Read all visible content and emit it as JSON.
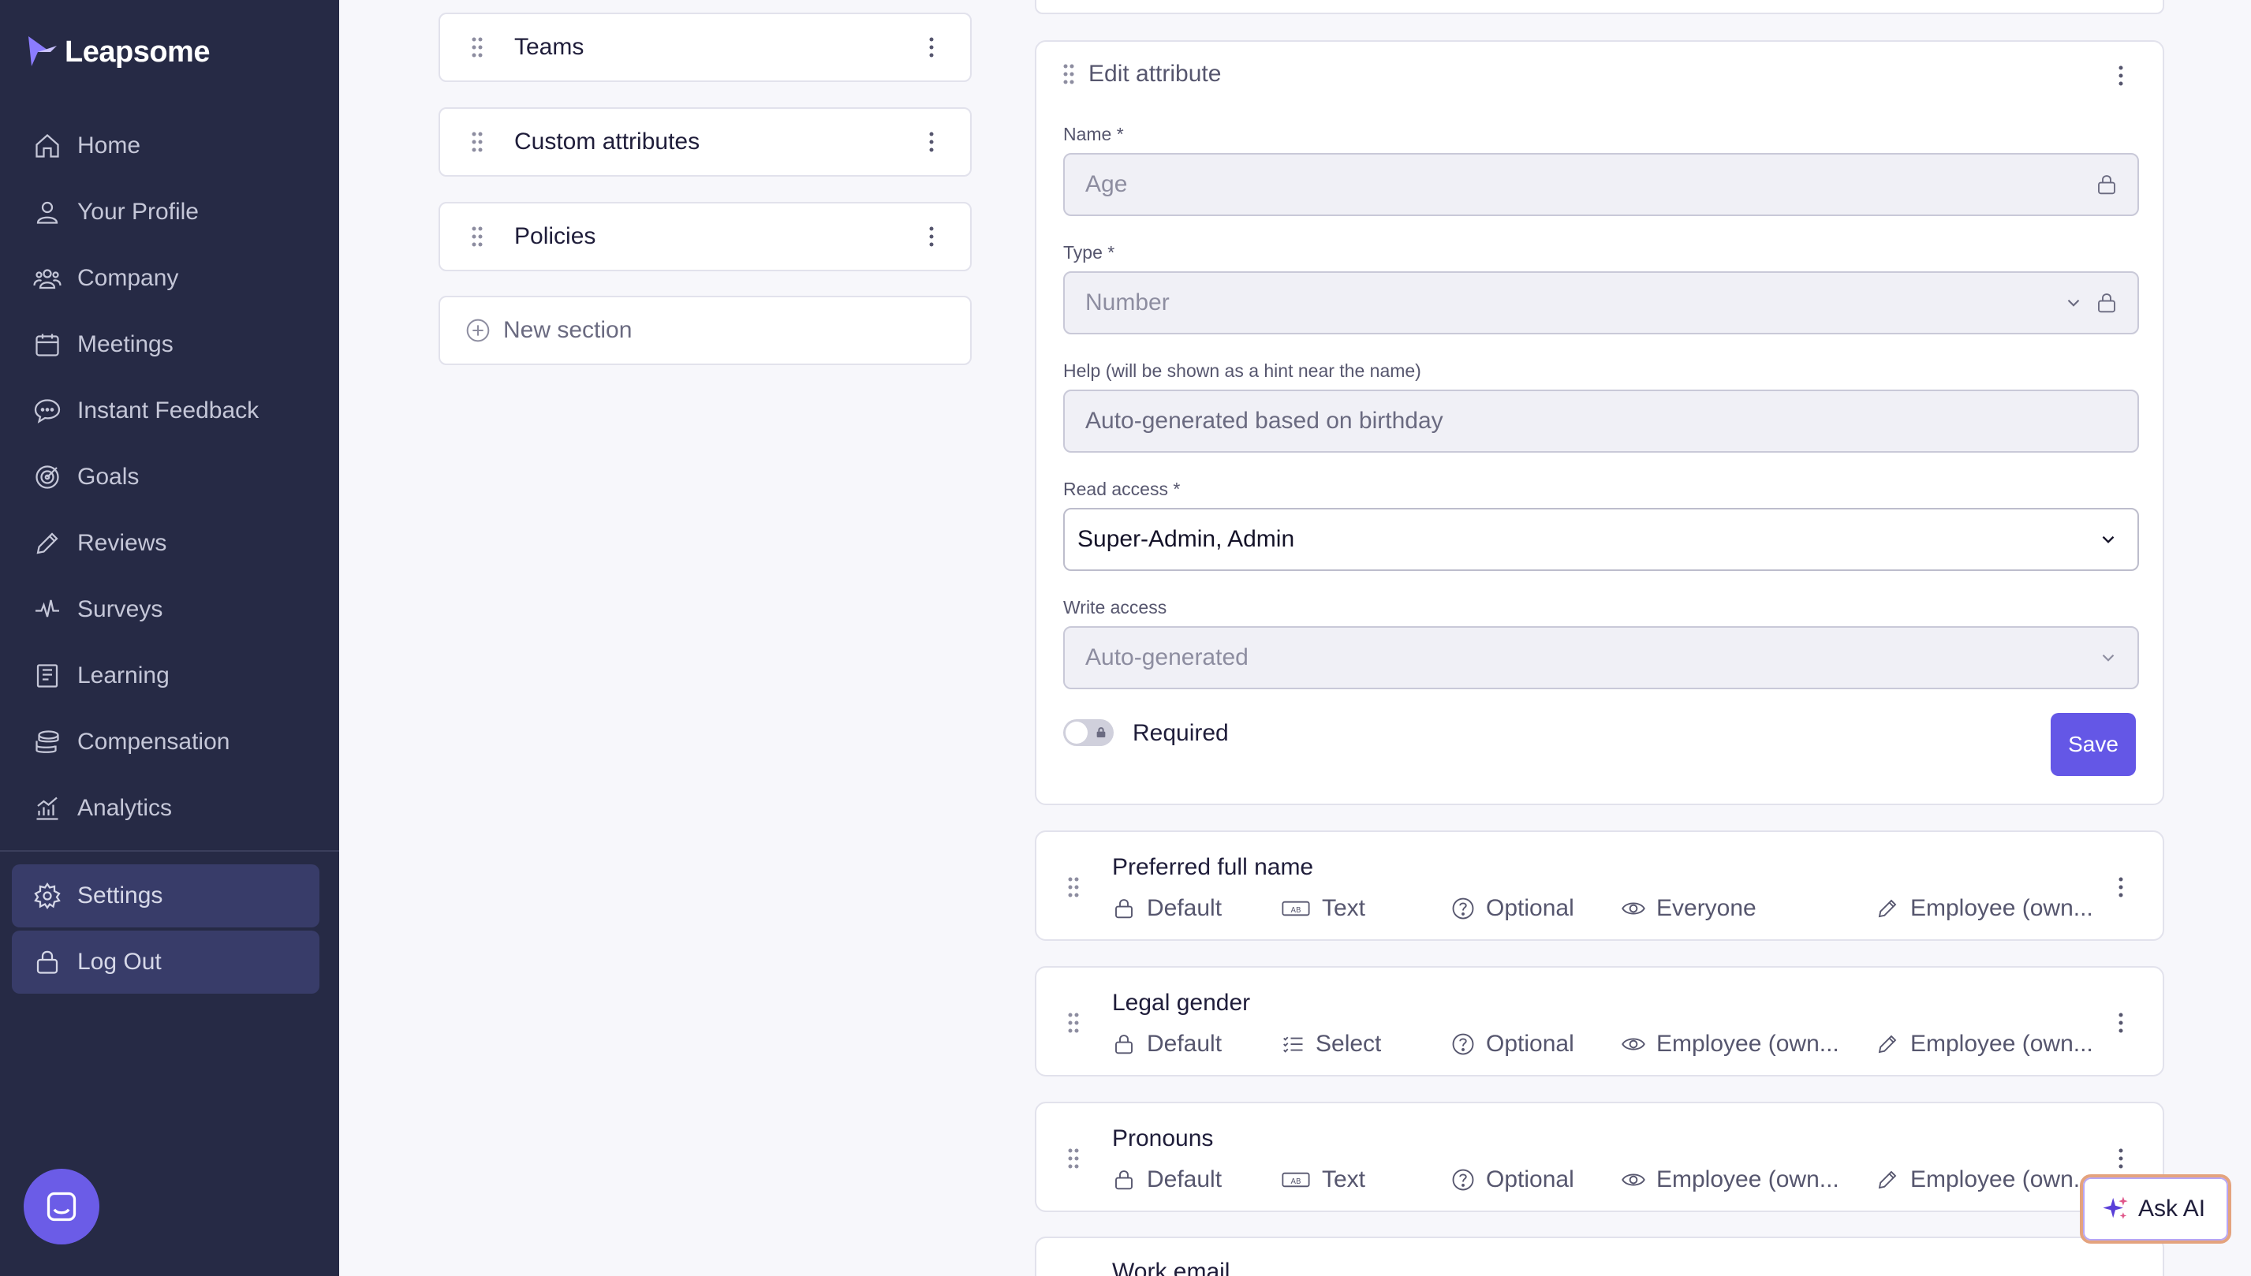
{
  "brand": {
    "name": "Leapsome",
    "accent": "#6457e6",
    "sidebar_bg": "#262a45"
  },
  "sidebar": {
    "items": [
      {
        "label": "Home",
        "icon": "home-icon"
      },
      {
        "label": "Your Profile",
        "icon": "user-icon"
      },
      {
        "label": "Company",
        "icon": "people-icon"
      },
      {
        "label": "Meetings",
        "icon": "calendar-icon"
      },
      {
        "label": "Instant Feedback",
        "icon": "chat-icon"
      },
      {
        "label": "Goals",
        "icon": "target-icon"
      },
      {
        "label": "Reviews",
        "icon": "pencil-icon"
      },
      {
        "label": "Surveys",
        "icon": "pulse-icon"
      },
      {
        "label": "Learning",
        "icon": "book-icon"
      },
      {
        "label": "Compensation",
        "icon": "coins-icon"
      },
      {
        "label": "Analytics",
        "icon": "chart-icon"
      }
    ],
    "settings_label": "Settings",
    "logout_label": "Log Out"
  },
  "sections": {
    "items": [
      "Teams",
      "Custom attributes",
      "Policies"
    ],
    "new_section_label": "New section"
  },
  "edit_attribute": {
    "title": "Edit attribute",
    "name_label": "Name *",
    "name_value": "Age",
    "type_label": "Type *",
    "type_value": "Number",
    "help_label": "Help (will be shown as a hint near the name)",
    "help_value": "Auto-generated based on birthday",
    "read_label": "Read access *",
    "read_value": "Super-Admin, Admin",
    "write_label": "Write access",
    "write_value": "Auto-generated",
    "required_label": "Required",
    "required_on": false,
    "save_label": "Save"
  },
  "attributes": [
    {
      "title": "Preferred full name",
      "origin": "Default",
      "type": "Text",
      "type_icon": "text-field-icon",
      "requirement": "Optional",
      "read": "Everyone",
      "write": "Employee (own..."
    },
    {
      "title": "Legal gender",
      "origin": "Default",
      "type": "Select",
      "type_icon": "list-icon",
      "requirement": "Optional",
      "read": "Employee (own...",
      "write": "Employee (own..."
    },
    {
      "title": "Pronouns",
      "origin": "Default",
      "type": "Text",
      "type_icon": "text-field-icon",
      "requirement": "Optional",
      "read": "Employee (own...",
      "write": "Employee (own..."
    }
  ],
  "next_attribute_title": "Work email",
  "ask_ai_label": "Ask AI"
}
